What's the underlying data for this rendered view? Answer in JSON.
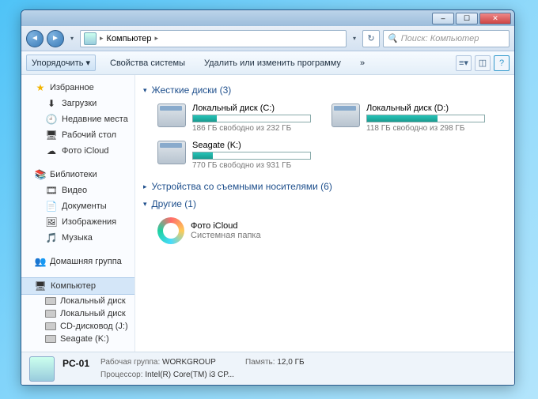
{
  "window": {
    "minimize": "–",
    "maximize": "☐",
    "close": "✕"
  },
  "address": {
    "root_icon_name": "computer-icon",
    "path": "Компьютер",
    "sep": "▸"
  },
  "search": {
    "placeholder": "Поиск: Компьютер",
    "icon": "🔍"
  },
  "toolbar": {
    "organize": "Упорядочить",
    "system_props": "Свойства системы",
    "change_program": "Удалить или изменить программу",
    "chevrons": "»"
  },
  "sidebar": {
    "favorites": {
      "label": "Избранное"
    },
    "fav_items": [
      {
        "icon": "⬇",
        "label": "Загрузки"
      },
      {
        "icon": "🕘",
        "label": "Недавние места"
      },
      {
        "icon": "🖥",
        "label": "Рабочий стол"
      },
      {
        "icon": "☁",
        "label": "Фото iCloud"
      }
    ],
    "libraries": {
      "label": "Библиотеки"
    },
    "lib_items": [
      {
        "icon": "🎞",
        "label": "Видео"
      },
      {
        "icon": "📄",
        "label": "Документы"
      },
      {
        "icon": "🖼",
        "label": "Изображения"
      },
      {
        "icon": "🎵",
        "label": "Музыка"
      }
    ],
    "homegroup": {
      "icon": "👥",
      "label": "Домашняя группа"
    },
    "computer": {
      "icon": "🖥",
      "label": "Компьютер"
    },
    "comp_items": [
      {
        "label": "Локальный диск"
      },
      {
        "label": "Локальный диск"
      },
      {
        "label": "CD-дисковод (J:)"
      },
      {
        "label": "Seagate (K:)"
      }
    ]
  },
  "content": {
    "hard_drives_hdr": "Жесткие диски (3)",
    "removable_hdr": "Устройства со съемными носителями (6)",
    "other_hdr": "Другие (1)",
    "drives": [
      {
        "name": "Локальный диск (C:)",
        "free": "186 ГБ свободно из 232 ГБ",
        "fill_pct": 20
      },
      {
        "name": "Локальный диск (D:)",
        "free": "118 ГБ свободно из 298 ГБ",
        "fill_pct": 60
      },
      {
        "name": "Seagate (K:)",
        "free": "770 ГБ свободно из 931 ГБ",
        "fill_pct": 17
      }
    ],
    "other": {
      "name": "Фото iCloud",
      "sub": "Системная папка"
    }
  },
  "status": {
    "pc_name": "PC-01",
    "workgroup_lbl": "Рабочая группа:",
    "workgroup": "WORKGROUP",
    "memory_lbl": "Память:",
    "memory": "12,0 ГБ",
    "cpu_lbl": "Процессор:",
    "cpu": "Intel(R) Core(TM) i3 CP..."
  }
}
